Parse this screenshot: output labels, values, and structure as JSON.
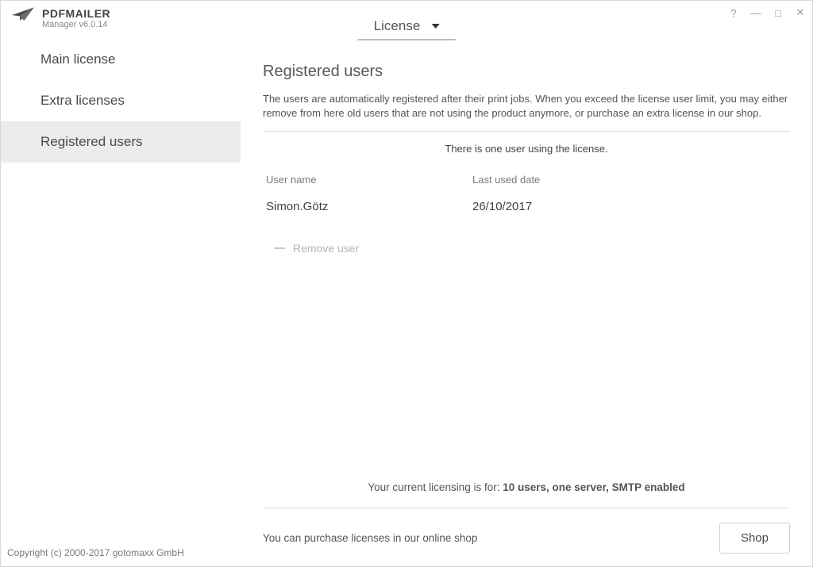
{
  "brand": {
    "title": "PDFMAILER",
    "subtitle": "Manager v6.0.14"
  },
  "header": {
    "dropdown_label": "License"
  },
  "window_controls": {
    "help": "?",
    "minimize": "—",
    "maximize": "□",
    "close": "✕"
  },
  "sidebar": {
    "items": [
      {
        "label": "Main license",
        "active": false
      },
      {
        "label": "Extra licenses",
        "active": false
      },
      {
        "label": "Registered users",
        "active": true
      }
    ]
  },
  "copyright": "Copyright (c) 2000-2017 gotomaxx GmbH",
  "main": {
    "title": "Registered users",
    "description": "The users are automatically registered after their print jobs. When you exceed the license user limit, you may either remove from here old users that are not using the product anymore, or purchase an extra license in our shop.",
    "status": "There is one user using the license.",
    "columns": {
      "user": "User name",
      "date": "Last used date"
    },
    "rows": [
      {
        "user": "Simon.Götz",
        "date": "26/10/2017"
      }
    ],
    "remove_label": "Remove user",
    "licensing_prefix": "Your current licensing is for: ",
    "licensing_bold": "10 users, one server, SMTP enabled",
    "footer_text": "You can purchase licenses in our online shop",
    "shop_button": "Shop"
  }
}
